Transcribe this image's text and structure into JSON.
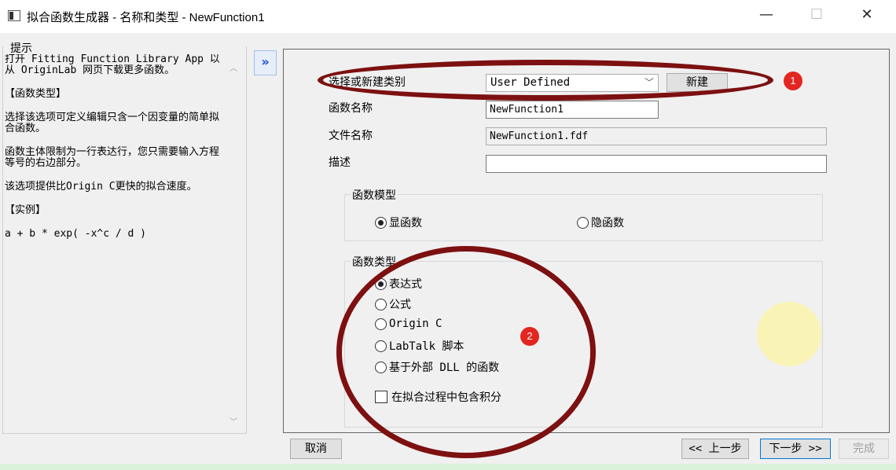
{
  "window": {
    "title": "拟合函数生成器 - 名称和类型 - NewFunction1",
    "minimize_glyph": "—",
    "maximize_glyph": "☐",
    "close_glyph": "✕"
  },
  "hint": {
    "title": "提示",
    "paragraphs": [
      "打开 Fitting Function Library App 以从 OriginLab 网页下载更多函数。",
      "【函数类型】",
      "选择该选项可定义编辑只含一个因变量的简单拟合函数。",
      "函数主体限制为一行表达行，您只需要输入方程等号的右边部分。",
      "该选项提供比Origin C更快的拟合速度。",
      "【实例】",
      "a + b * exp( -x^c / d )"
    ]
  },
  "expand_button": "»",
  "form": {
    "category_label": "选择或新建类别",
    "category_value": "User Defined",
    "new_button": "新建",
    "function_name_label": "函数名称",
    "function_name_value": "NewFunction1",
    "file_name_label": "文件名称",
    "file_name_value": "NewFunction1.fdf",
    "description_label": "描述",
    "description_value": ""
  },
  "model_group": {
    "title": "函数模型",
    "options": [
      "显函数",
      "隐函数"
    ],
    "selected": "显函数"
  },
  "type_group": {
    "title": "函数类型",
    "options": [
      "表达式",
      "公式",
      "Origin C",
      "LabTalk 脚本",
      "基于外部 DLL 的函数"
    ],
    "selected": "表达式",
    "integral_checkbox": "在拟合过程中包含积分",
    "integral_checked": false
  },
  "annotations": {
    "badge_1": "1",
    "badge_2": "2",
    "color": "#7d1010",
    "badge_color": "#e3261f"
  },
  "buttons": {
    "cancel": "取消",
    "prev": "<< 上一步",
    "next": "下一步 >>",
    "finish": "完成"
  }
}
